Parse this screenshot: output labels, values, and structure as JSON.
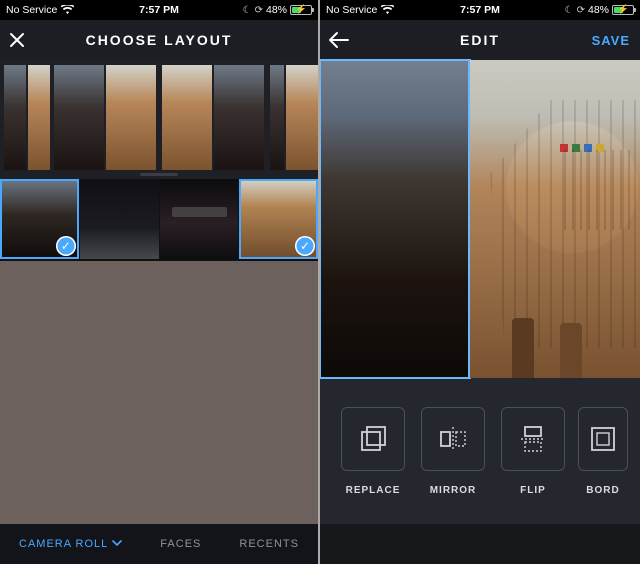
{
  "status": {
    "carrier": "No Service",
    "time": "7:57 PM",
    "battery_pct": "48%"
  },
  "left": {
    "nav": {
      "title": "CHOOSE LAYOUT"
    },
    "tabs": {
      "camera_roll": "CAMERA ROLL",
      "faces": "FACES",
      "recents": "RECENTS"
    }
  },
  "right": {
    "nav": {
      "title": "EDIT",
      "save": "SAVE"
    },
    "tools": {
      "replace": "REPLACE",
      "mirror": "MIRROR",
      "flip": "FLIP",
      "border": "BORDER"
    }
  }
}
